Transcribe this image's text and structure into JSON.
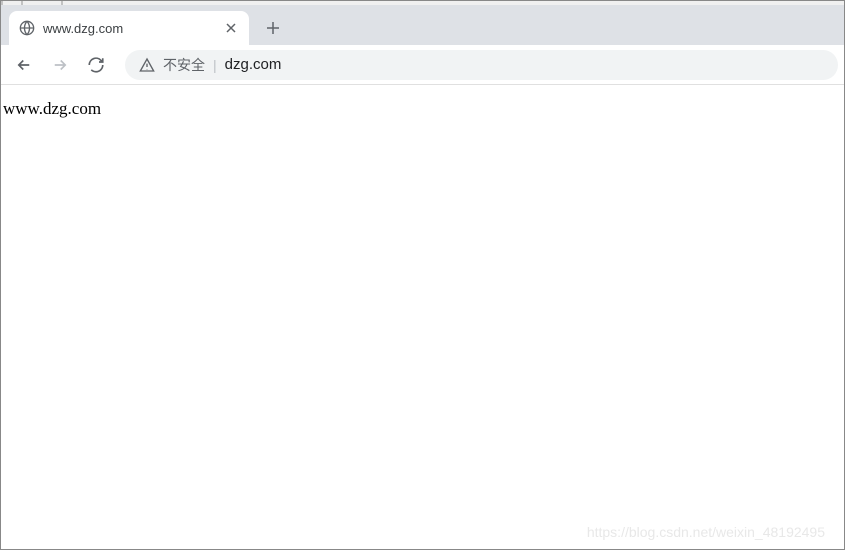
{
  "tab": {
    "title": "www.dzg.com"
  },
  "addressBar": {
    "securityText": "不安全",
    "url": "dzg.com"
  },
  "page": {
    "bodyText": "www.dzg.com"
  },
  "watermark": "https://blog.csdn.net/weixin_48192495"
}
